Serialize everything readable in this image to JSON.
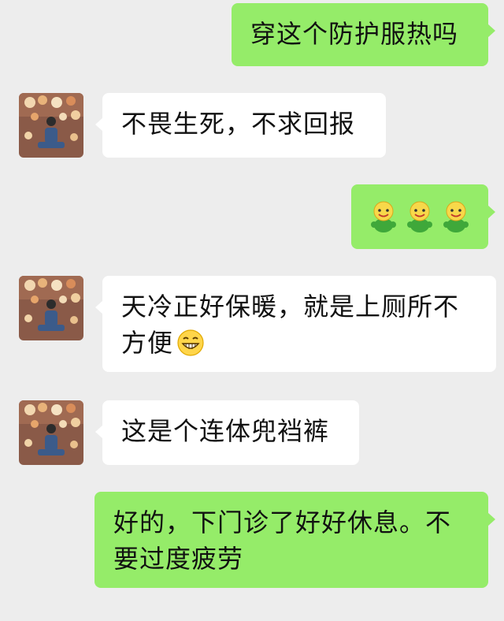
{
  "messages": [
    {
      "id": "m1",
      "direction": "outgoing",
      "text": "穿这个防护服热吗"
    },
    {
      "id": "m2",
      "direction": "incoming",
      "text": "不畏生死，不求回报"
    },
    {
      "id": "m3",
      "direction": "outgoing",
      "emoji": [
        "smile-green-doll-emoji",
        "smile-green-doll-emoji",
        "smile-green-doll-emoji"
      ]
    },
    {
      "id": "m4",
      "direction": "incoming",
      "line1": "天冷正好保暖，就是上厕所不",
      "line2": "方便",
      "emoji": "grin-emoji"
    },
    {
      "id": "m5",
      "direction": "incoming",
      "text": "这是个连体兜裆裤"
    },
    {
      "id": "m6",
      "direction": "outgoing",
      "line1": "好的，下门诊了好好休息。不",
      "line2": "要过度疲劳"
    }
  ],
  "colors": {
    "background": "#ededed",
    "outgoing_bubble": "#95ec69",
    "incoming_bubble": "#ffffff",
    "text": "#111111"
  }
}
